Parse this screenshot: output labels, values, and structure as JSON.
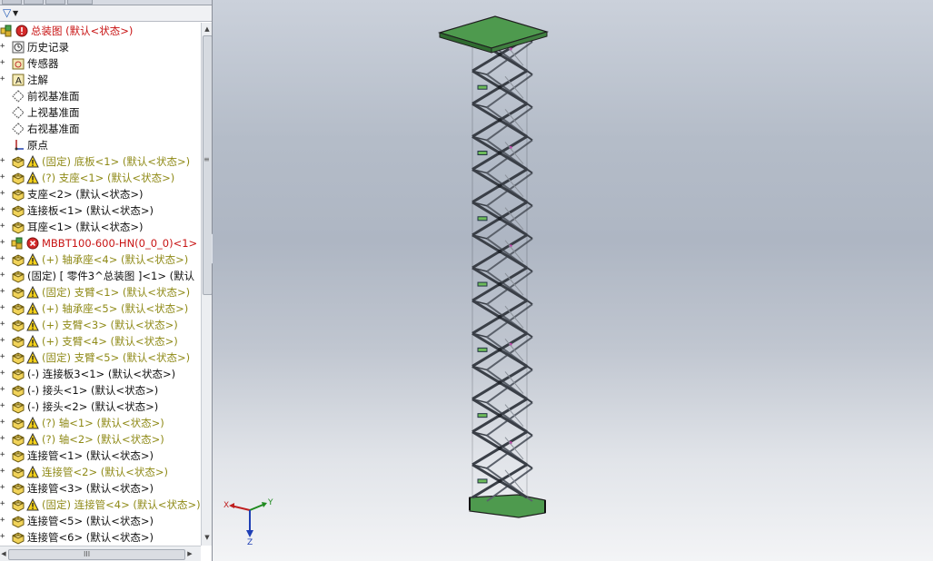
{
  "feature_tree": {
    "root": {
      "label": "总装图 (默认<状态>)",
      "icon": "assembly-icon",
      "status": "rebuild-error"
    },
    "items": [
      {
        "label": "历史记录",
        "icon": "history-icon",
        "color": "black"
      },
      {
        "label": "传感器",
        "icon": "sensor-icon",
        "color": "black"
      },
      {
        "label": "注解",
        "icon": "annotation-icon",
        "color": "black"
      },
      {
        "label": "前视基准面",
        "icon": "plane-icon",
        "color": "black"
      },
      {
        "label": "上视基准面",
        "icon": "plane-icon",
        "color": "black"
      },
      {
        "label": "右视基准面",
        "icon": "plane-icon",
        "color": "black"
      },
      {
        "label": "原点",
        "icon": "origin-icon",
        "color": "black"
      },
      {
        "label": "(固定) 底板<1> (默认<状态>)",
        "icon": "part-icon",
        "color": "olive",
        "warning": true
      },
      {
        "label": "(?) 支座<1> (默认<状态>)",
        "icon": "part-icon",
        "color": "olive",
        "warning": true
      },
      {
        "label": "支座<2> (默认<状态>)",
        "icon": "part-icon",
        "color": "black"
      },
      {
        "label": "连接板<1> (默认<状态>)",
        "icon": "part-icon",
        "color": "black"
      },
      {
        "label": "耳座<1> (默认<状态>)",
        "icon": "part-icon",
        "color": "black"
      },
      {
        "label": "MBBT100-600-HN(0_0_0)<1>",
        "icon": "subassembly-icon",
        "color": "red",
        "error": true
      },
      {
        "label": "(+) 轴承座<4> (默认<状态>)",
        "icon": "part-icon",
        "color": "olive",
        "warning": true
      },
      {
        "label": "(固定) [ 零件3^总装图 ]<1> (默认",
        "icon": "part-icon",
        "color": "black"
      },
      {
        "label": "(固定) 支臂<1> (默认<状态>)",
        "icon": "part-icon",
        "color": "olive",
        "warning": true
      },
      {
        "label": "(+) 轴承座<5> (默认<状态>)",
        "icon": "part-icon",
        "color": "olive",
        "warning": true
      },
      {
        "label": "(+) 支臂<3> (默认<状态>)",
        "icon": "part-icon",
        "color": "olive",
        "warning": true
      },
      {
        "label": "(+) 支臂<4> (默认<状态>)",
        "icon": "part-icon",
        "color": "olive",
        "warning": true
      },
      {
        "label": "(固定) 支臂<5> (默认<状态>)",
        "icon": "part-icon",
        "color": "olive",
        "warning": true
      },
      {
        "label": "(-) 连接板3<1> (默认<状态>)",
        "icon": "part-icon",
        "color": "black"
      },
      {
        "label": "(-) 接头<1> (默认<状态>)",
        "icon": "part-icon",
        "color": "black"
      },
      {
        "label": "(-) 接头<2> (默认<状态>)",
        "icon": "part-icon",
        "color": "black"
      },
      {
        "label": "(?) 轴<1> (默认<状态>)",
        "icon": "part-icon",
        "color": "olive",
        "warning": true
      },
      {
        "label": "(?) 轴<2> (默认<状态>)",
        "icon": "part-icon",
        "color": "olive",
        "warning": true
      },
      {
        "label": "连接管<1> (默认<状态>)",
        "icon": "part-icon",
        "color": "black"
      },
      {
        "label": "连接管<2> (默认<状态>)",
        "icon": "part-icon",
        "color": "olive",
        "warning": true
      },
      {
        "label": "连接管<3> (默认<状态>)",
        "icon": "part-icon",
        "color": "black"
      },
      {
        "label": "(固定) 连接管<4> (默认<状态>)",
        "icon": "part-icon",
        "color": "olive",
        "warning": true
      },
      {
        "label": "连接管<5> (默认<状态>)",
        "icon": "part-icon",
        "color": "black"
      },
      {
        "label": "连接管<6> (默认<状态>)",
        "icon": "part-icon",
        "color": "black"
      }
    ]
  },
  "scrollbar": {
    "h_grip": "III"
  },
  "triad": {
    "x": "X",
    "y": "Y",
    "z": "Z"
  },
  "colors": {
    "platform": "#4e9a4e",
    "frame": "#3a3f47",
    "viewport_top": "#cbd1db",
    "viewport_bottom": "#f3f4f6"
  }
}
